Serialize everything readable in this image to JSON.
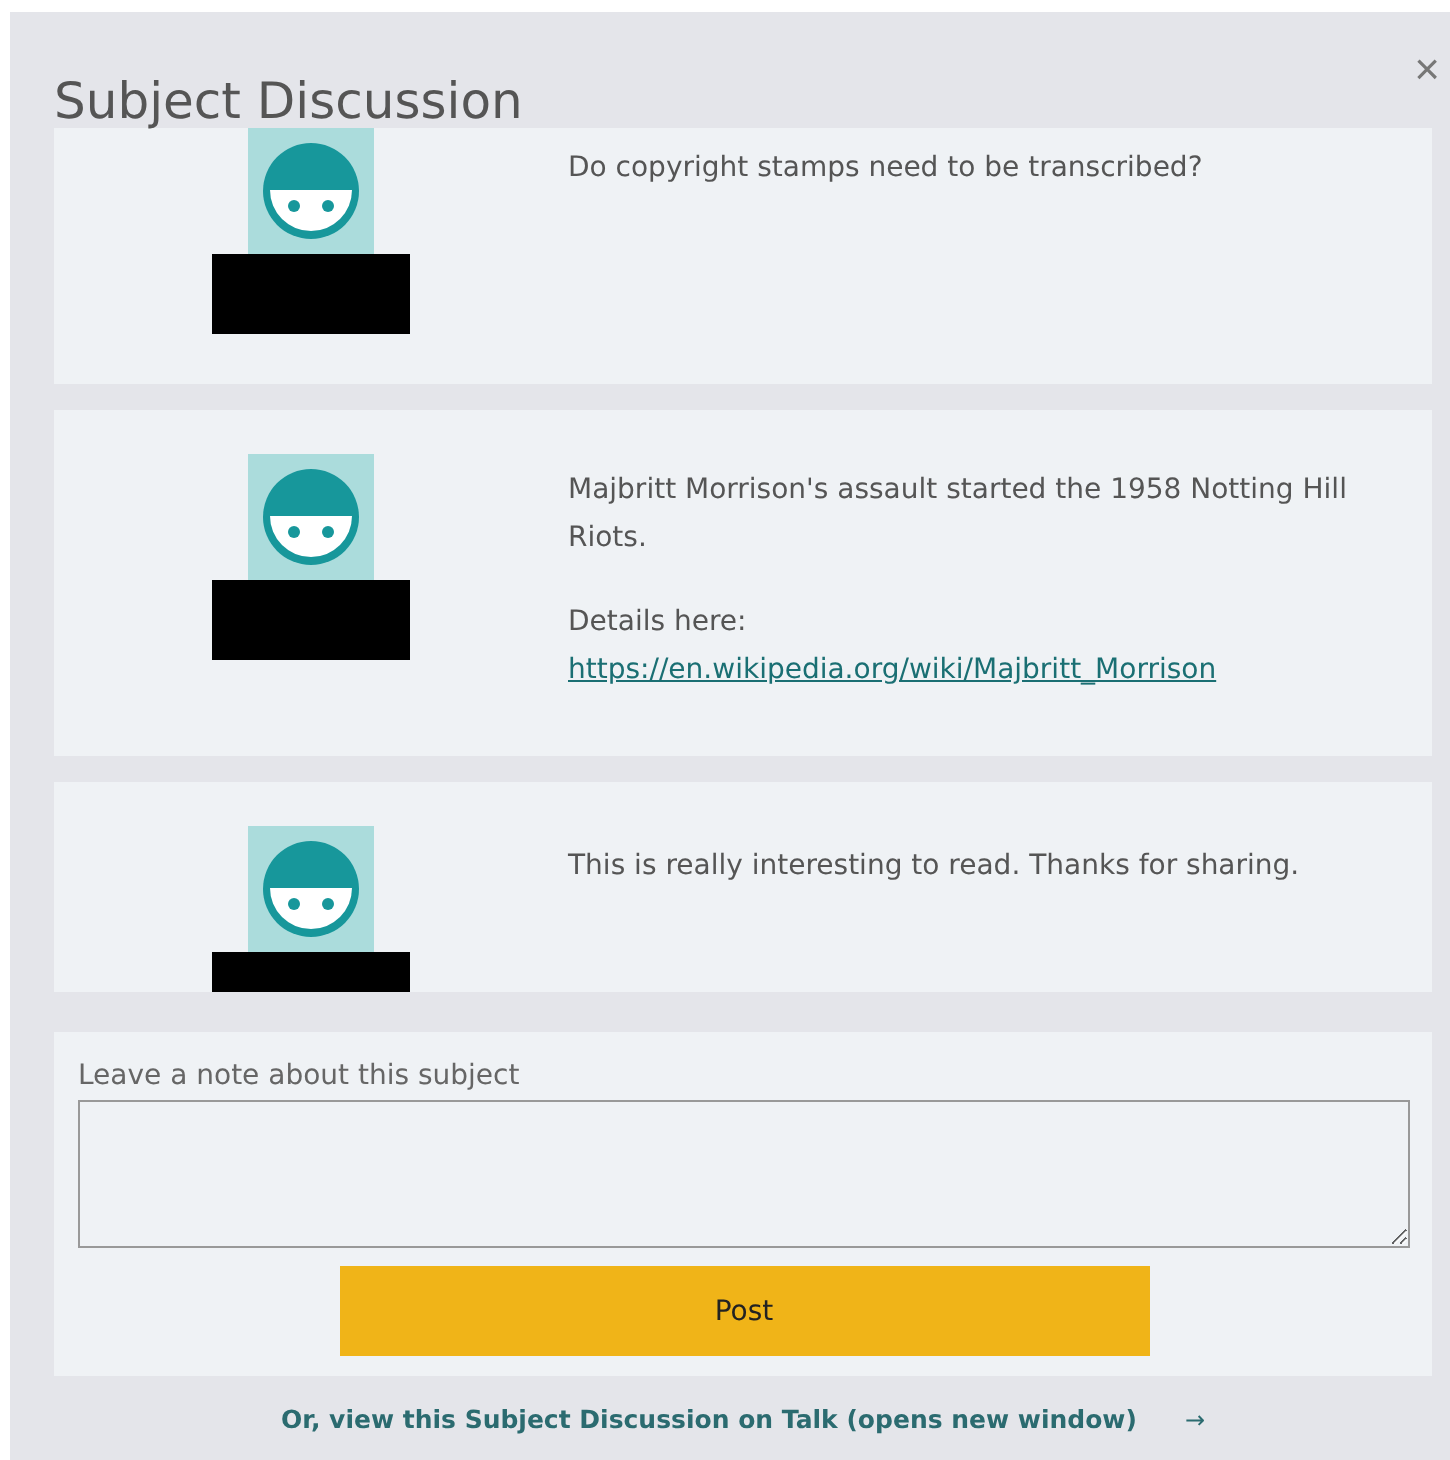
{
  "dialog": {
    "title": "Subject Discussion",
    "close": "×"
  },
  "comments": [
    {
      "blocks": [
        {
          "kind": "text",
          "text": "Do copyright stamps need to be transcribed?"
        }
      ]
    },
    {
      "blocks": [
        {
          "kind": "text",
          "text": "Majbritt Morrison's assault started the 1958 Notting Hill Riots."
        },
        {
          "kind": "text",
          "text": "Details here:"
        },
        {
          "kind": "link",
          "text": "https://en.wikipedia.org/wiki/Majbritt_Morrison"
        }
      ]
    },
    {
      "blocks": [
        {
          "kind": "text",
          "text": "This is really interesting to read. Thanks for sharing."
        }
      ]
    }
  ],
  "note_form": {
    "label": "Leave a note about this subject",
    "button": "Post"
  },
  "talk_link": {
    "text": "Or, view this Subject Discussion on Talk (opens new window)",
    "arrow": "→"
  }
}
